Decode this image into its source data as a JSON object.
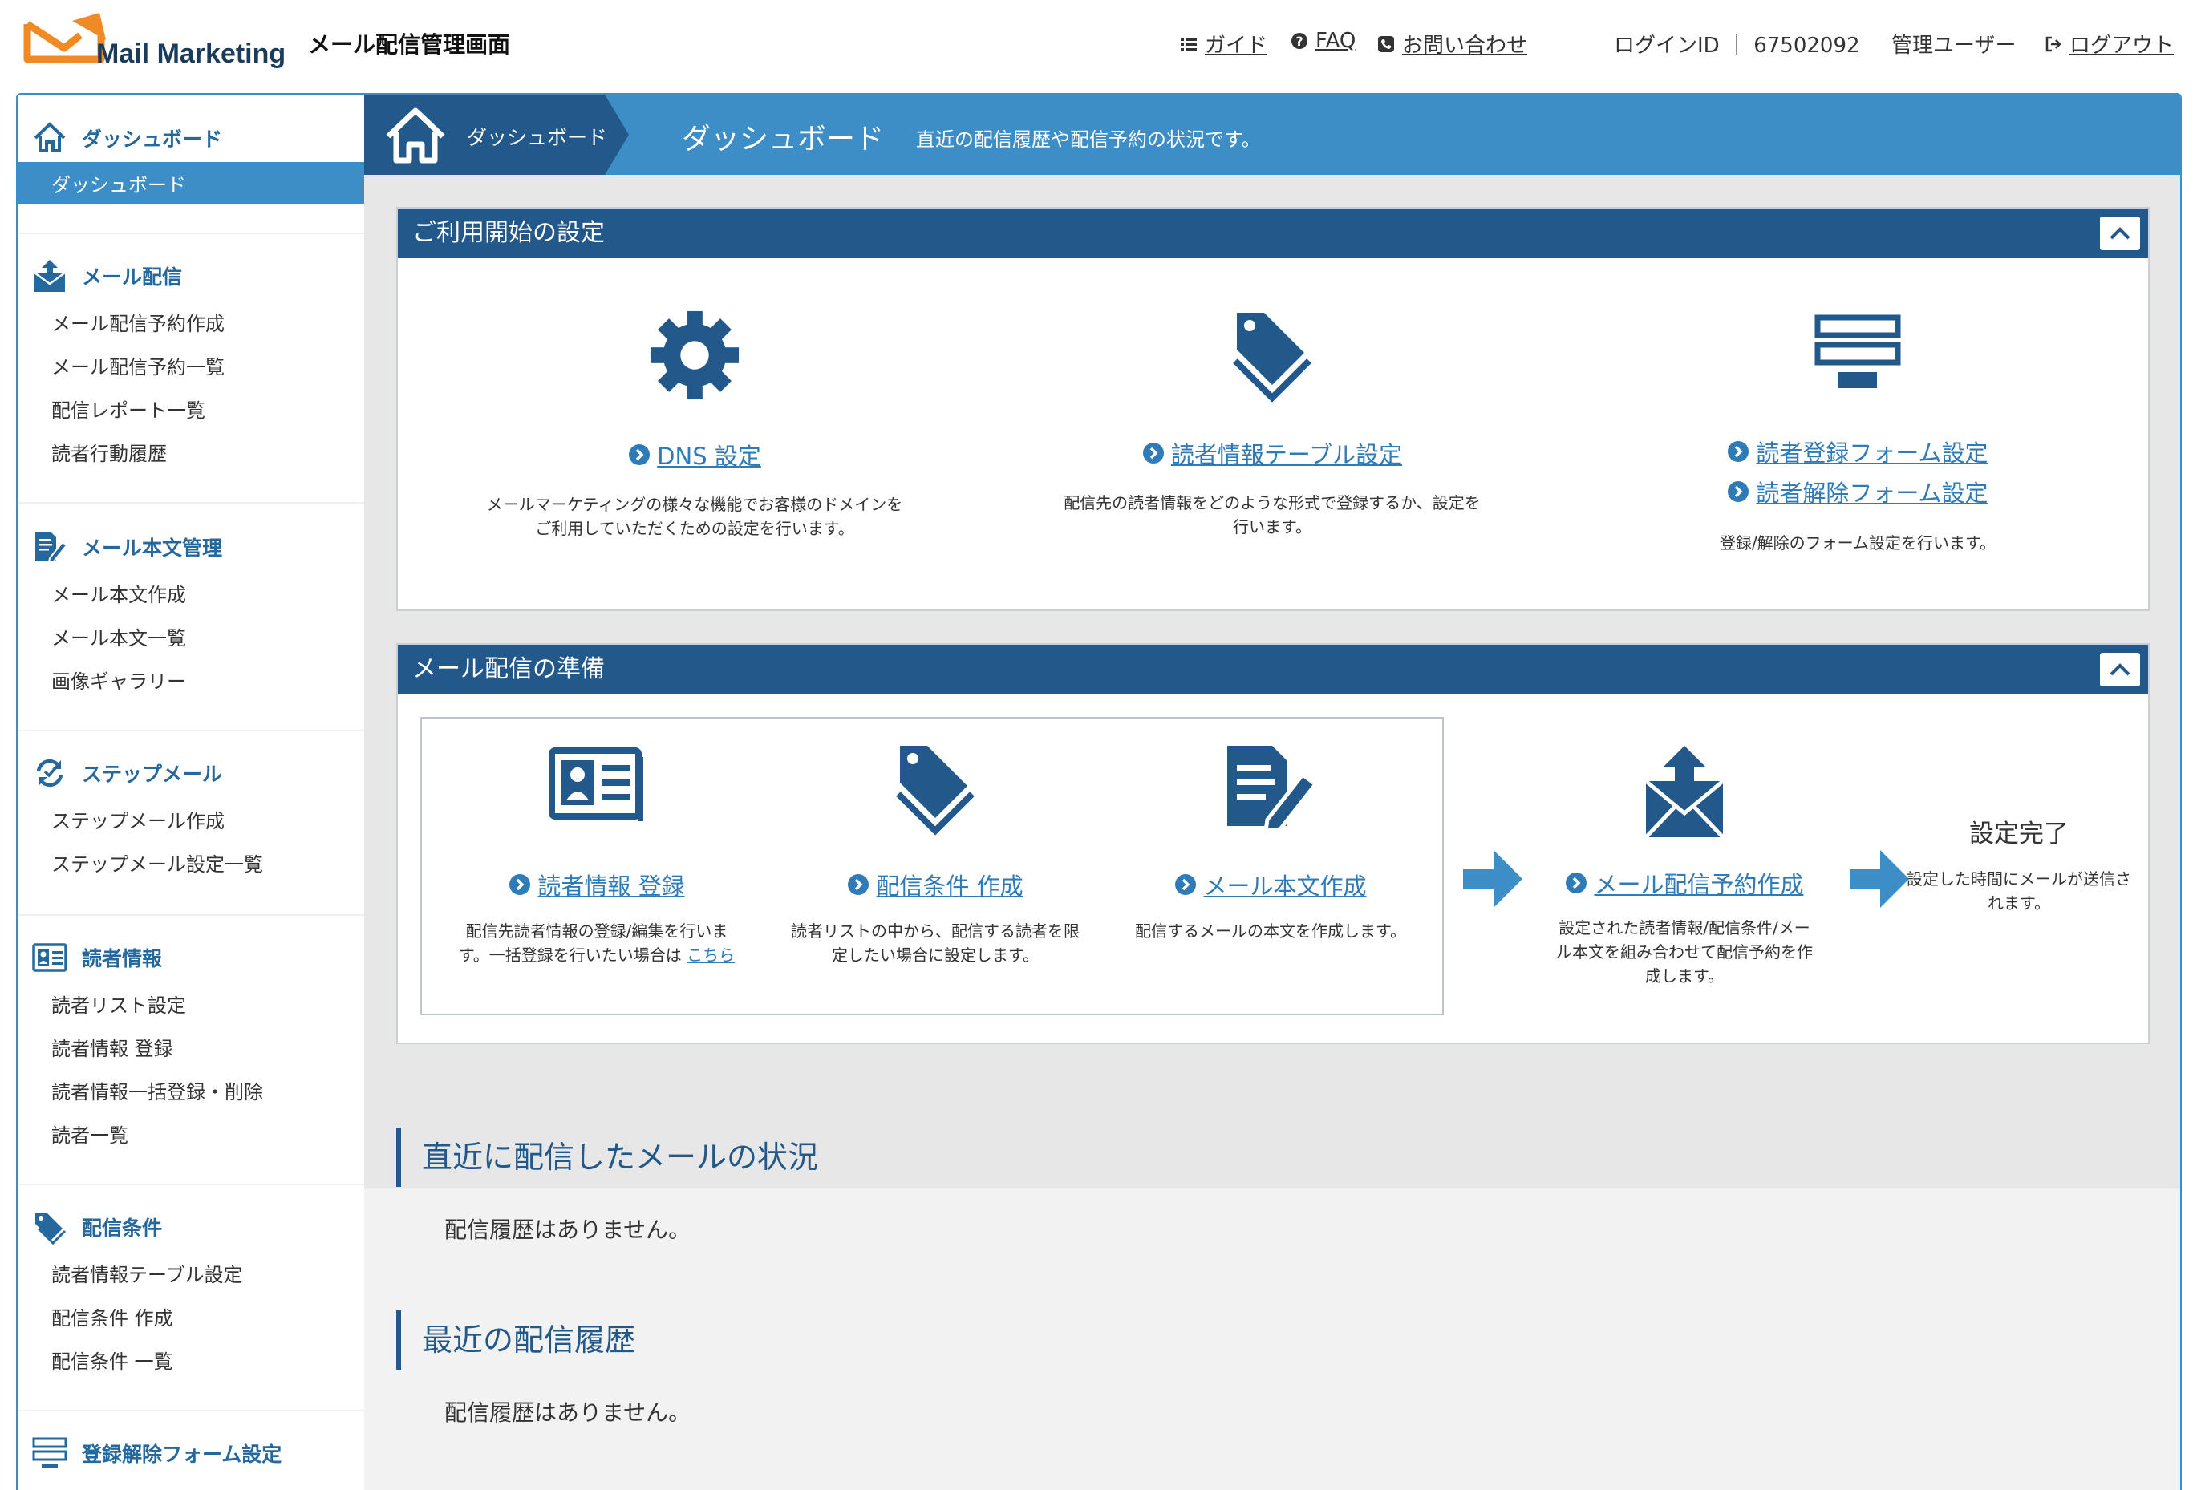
{
  "header": {
    "brand": "Mail Marketing",
    "app_title": "メール配信管理画面",
    "nav": [
      {
        "label": "ガイド",
        "icon": "list-icon"
      },
      {
        "label": "FAQ",
        "icon": "question-icon"
      },
      {
        "label": "お問い合わせ",
        "icon": "phone-icon"
      }
    ],
    "login_label": "ログインID ｜ 67502092",
    "user_label": "管理ユーザー",
    "logout_label": "ログアウト"
  },
  "sidebar": {
    "sections": [
      {
        "title": "ダッシュボード",
        "icon": "home-icon",
        "items": [
          "ダッシュボード"
        ]
      },
      {
        "title": "メール配信",
        "icon": "mail-send-icon",
        "items": [
          "メール配信予約作成",
          "メール配信予約一覧",
          "配信レポート一覧",
          "読者行動履歴"
        ]
      },
      {
        "title": "メール本文管理",
        "icon": "document-edit-icon",
        "items": [
          "メール本文作成",
          "メール本文一覧",
          "画像ギャラリー"
        ]
      },
      {
        "title": "ステップメール",
        "icon": "refresh-icon",
        "items": [
          "ステップメール作成",
          "ステップメール設定一覧"
        ]
      },
      {
        "title": "読者情報",
        "icon": "id-card-icon",
        "items": [
          "読者リスト設定",
          "読者情報 登録",
          "読者情報一括登録・削除",
          "読者一覧"
        ]
      },
      {
        "title": "配信条件",
        "icon": "tag-icon",
        "items": [
          "読者情報テーブル設定",
          "配信条件 作成",
          "配信条件 一覧"
        ]
      },
      {
        "title": "登録解除フォーム設定",
        "icon": "form-icon",
        "items": []
      }
    ],
    "active_item": "ダッシュボード"
  },
  "banner": {
    "breadcrumb": "ダッシュボード",
    "title": "ダッシュボード",
    "description": "直近の配信履歴や配信予約の状況です。"
  },
  "setup_panel": {
    "title": "ご利用開始の設定",
    "features": [
      {
        "icon": "gear-icon",
        "links": [
          "DNS 設定"
        ],
        "desc": [
          "メールマーケティングの様々な機能でお客様のドメインを",
          "ご利用していただくための設定を行います。"
        ]
      },
      {
        "icon": "tag-icon",
        "links": [
          "読者情報テーブル設定"
        ],
        "desc": [
          "配信先の読者情報をどのような形式で登録するか、設定を",
          "行います。"
        ]
      },
      {
        "icon": "form-icon",
        "links": [
          "読者登録フォーム設定",
          "読者解除フォーム設定"
        ],
        "desc": [
          "登録/解除のフォーム設定を行います。"
        ]
      }
    ]
  },
  "prep_panel": {
    "title": "メール配信の準備",
    "steps": [
      {
        "icon": "id-card-icon",
        "link": "読者情報 登録",
        "desc": [
          "配信先読者情報の登録/編集を行いま",
          "す。一括登録を行いたい場合は "
        ],
        "extra_link": "こちら"
      },
      {
        "icon": "tag-icon",
        "link": "配信条件 作成",
        "desc": [
          "読者リストの中から、配信する読者を限",
          "定したい場合に設定します。"
        ]
      },
      {
        "icon": "document-edit-icon",
        "link": "メール本文作成",
        "desc": [
          "配信するメールの本文を作成します。"
        ]
      },
      {
        "icon": "mail-send-icon",
        "link": "メール配信予約作成",
        "desc": [
          "設定された読者情報/配信条件/メー",
          "ル本文を組み合わせて配信予約を作",
          "成します。"
        ]
      }
    ],
    "complete": {
      "title": "設定完了",
      "desc": [
        "設定した時間にメールが送信さ",
        "れます。"
      ]
    }
  },
  "recent_status": {
    "title": "直近に配信したメールの状況",
    "text": "配信履歴はありません。"
  },
  "recent_history": {
    "title": "最近の配信履歴",
    "text": "配信履歴はありません。"
  },
  "colors": {
    "primary": "#3d8dc7",
    "dark": "#22588a",
    "link": "#2f7bb8",
    "logo": "#f08a24"
  }
}
